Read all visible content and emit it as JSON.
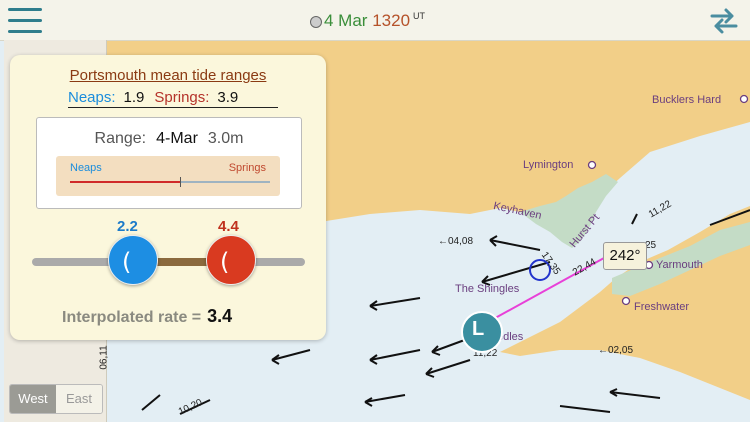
{
  "header": {
    "date": "4 Mar",
    "time": "1320",
    "time_zone": "UT",
    "menu_icon": "hamburger-icon",
    "sync_icon": "sync-arrows-icon"
  },
  "tide_panel": {
    "title": "Portsmouth mean tide ranges",
    "neaps_label": "Neaps:",
    "neaps_value": "1.9",
    "springs_label": "Springs:",
    "springs_value": "3.9",
    "range_label": "Range:",
    "range_date": "4-Mar",
    "range_value": "3.0m",
    "bar_neaps_label": "Neaps",
    "bar_springs_label": "Springs",
    "range_position_fraction": 0.55,
    "slider_left_value": "2.2",
    "slider_right_value": "4.4",
    "interpolated_label": "Interpolated rate =",
    "interpolated_value": "3.4"
  },
  "direction_toggle": {
    "west": "West",
    "east": "East",
    "selected": "West"
  },
  "map": {
    "places": [
      "Bucklers Hard",
      "Lymington",
      "Keyhaven",
      "Hurst Pt",
      "Yarmouth",
      "Freshwater",
      "The Shingles",
      "edles"
    ],
    "rates": [
      "04,08",
      "11,22",
      "25",
      "17,35",
      "22,44",
      "11,22",
      "02,05",
      "10,20",
      "06,11"
    ],
    "bearing": "242°",
    "colors": {
      "sea": "#e3eef4",
      "land": "#f2cf88",
      "marsh": "#c4dcc6",
      "route": "#e840d8",
      "accent": "#2f7d8c"
    }
  }
}
